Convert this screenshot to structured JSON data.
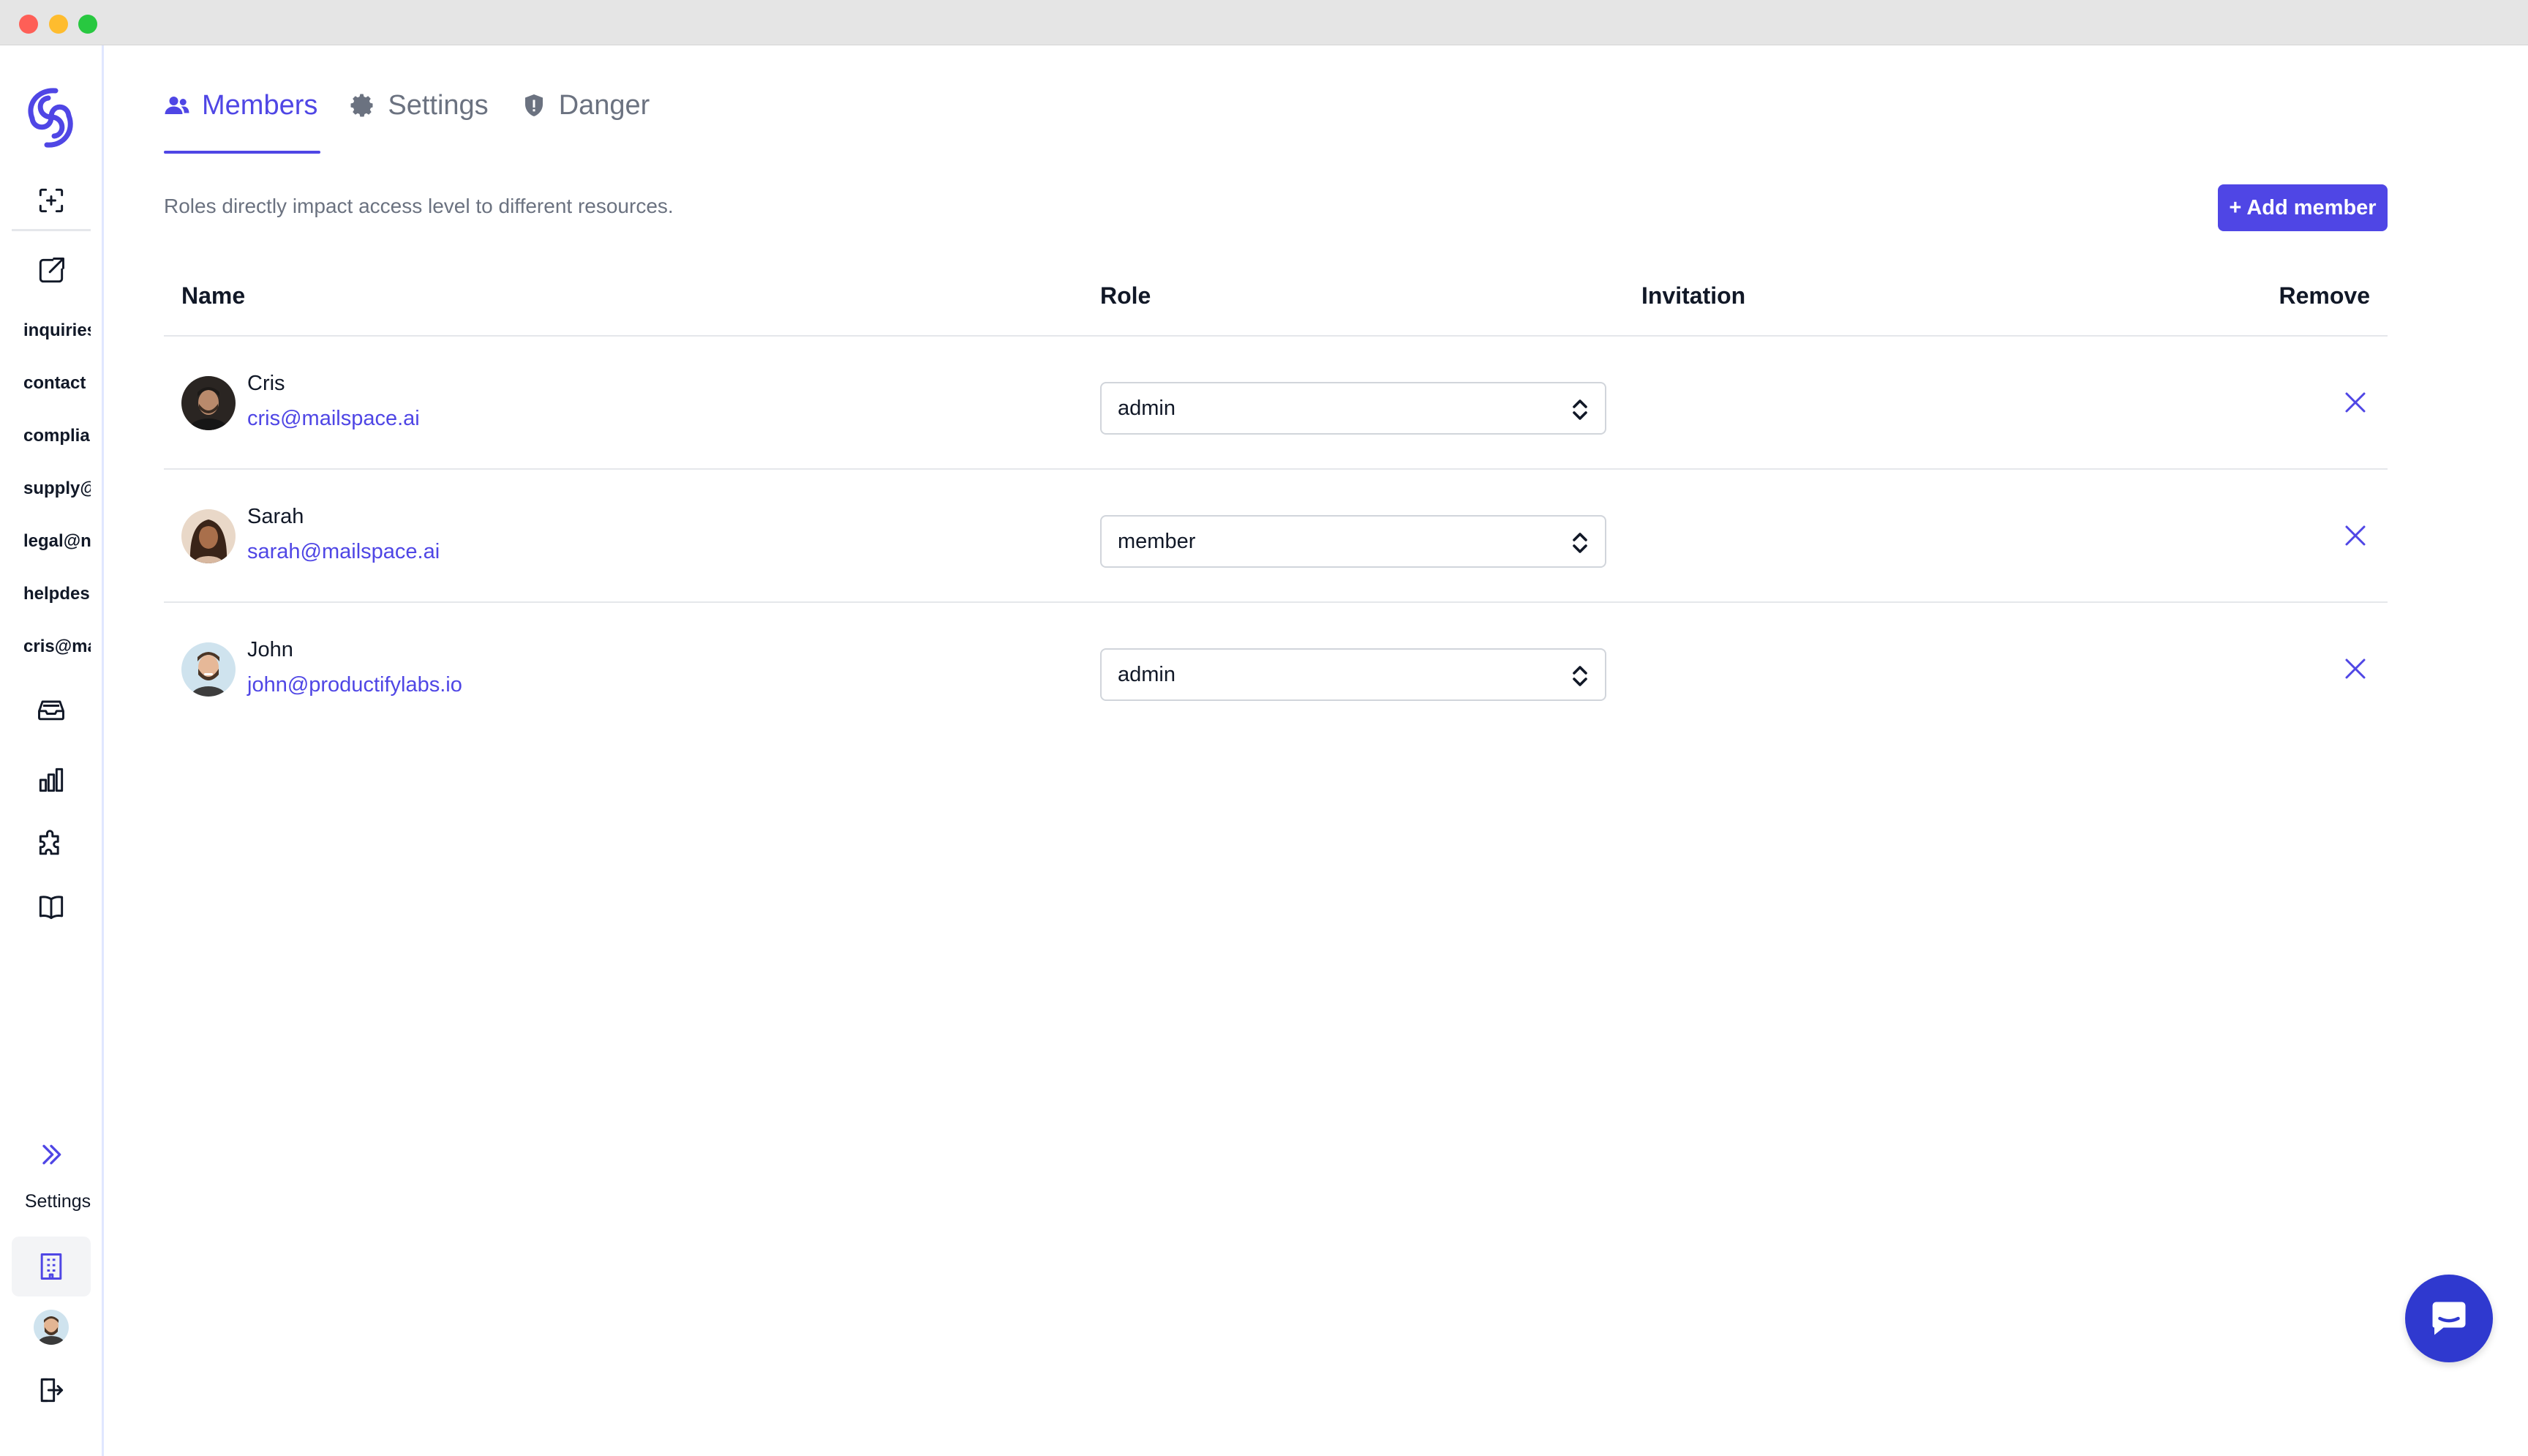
{
  "window": {
    "traffic_lights": [
      "close",
      "minimize",
      "maximize"
    ]
  },
  "sidebar": {
    "logo_icon": "spiral-logo-icon",
    "top_icons": [
      "scan-icon",
      "compose-icon"
    ],
    "inboxes": [
      "inquiries",
      "contact",
      "complia",
      "supply@",
      "legal@n",
      "helpdes",
      "cris@ma"
    ],
    "nav_icons": [
      "inbox-tray-icon",
      "analytics-icon",
      "puzzle-icon",
      "book-icon"
    ],
    "collapse_icon": "double-chevron-right-icon",
    "settings_label": "Settings",
    "bottom_icons": [
      "building-icon",
      "user-avatar",
      "logout-icon"
    ]
  },
  "tabs": [
    {
      "label": "Members",
      "icon": "users-icon",
      "active": true
    },
    {
      "label": "Settings",
      "icon": "gear-icon",
      "active": false
    },
    {
      "label": "Danger",
      "icon": "shield-icon",
      "active": false
    }
  ],
  "description": "Roles directly impact access level to different resources.",
  "add_member_label": "+ Add member",
  "table": {
    "headers": {
      "name": "Name",
      "role": "Role",
      "invitation": "Invitation",
      "remove": "Remove"
    },
    "rows": [
      {
        "name": "Cris",
        "email": "cris@mailspace.ai",
        "role": "admin",
        "invitation": ""
      },
      {
        "name": "Sarah",
        "email": "sarah@mailspace.ai",
        "role": "member",
        "invitation": ""
      },
      {
        "name": "John",
        "email": "john@productifylabs.io",
        "role": "admin",
        "invitation": ""
      }
    ]
  },
  "colors": {
    "accent": "#4f46e5",
    "chat_button": "#2f39cf",
    "muted_text": "#6b7280",
    "border": "#e5e7eb"
  },
  "chat_icon": "chat-bubble-icon"
}
